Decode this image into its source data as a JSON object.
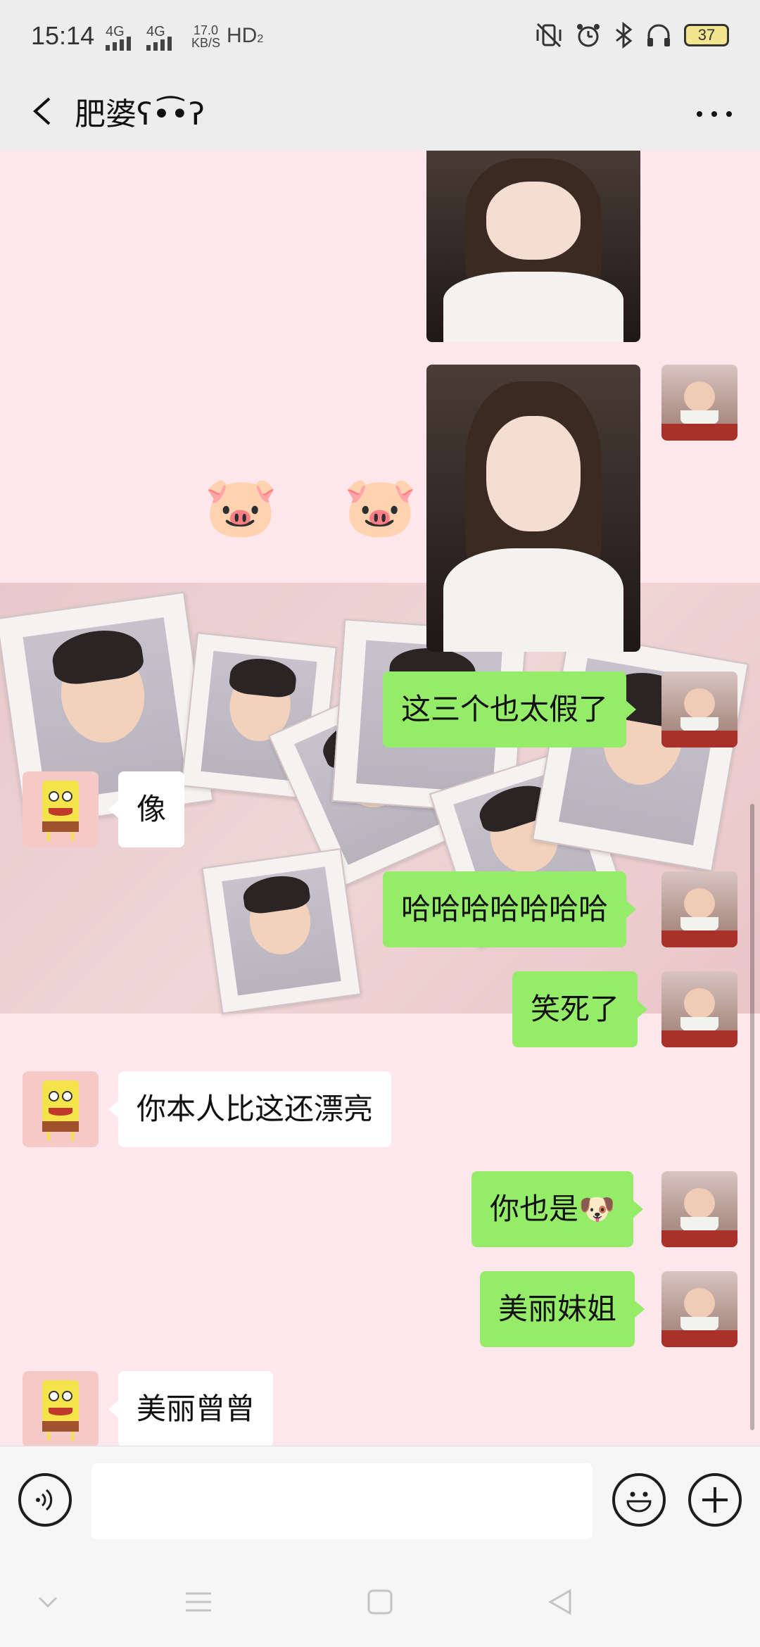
{
  "status_bar": {
    "time": "15:14",
    "signal1": "4G",
    "signal2": "4G",
    "speed_value": "17.0",
    "speed_unit": "KB/S",
    "hd": "HD",
    "hd_sub": "2",
    "battery": "37"
  },
  "header": {
    "title": "肥婆ʕ•͡•ʔ"
  },
  "messages": [
    {
      "side": "me",
      "type": "image"
    },
    {
      "side": "me",
      "type": "image"
    },
    {
      "side": "me",
      "type": "text",
      "text": "这三个也太假了"
    },
    {
      "side": "other",
      "type": "text",
      "text": "像"
    },
    {
      "side": "me",
      "type": "text",
      "text": "哈哈哈哈哈哈哈"
    },
    {
      "side": "me",
      "type": "text",
      "text": "笑死了"
    },
    {
      "side": "other",
      "type": "text",
      "text": "你本人比这还漂亮"
    },
    {
      "side": "me",
      "type": "text",
      "text": "你也是🐶"
    },
    {
      "side": "me",
      "type": "text",
      "text": "美丽妹姐"
    },
    {
      "side": "other",
      "type": "text",
      "text": "美丽曾曾"
    }
  ],
  "wallpaper_emoji": "🐷",
  "input": {
    "value": "",
    "placeholder": ""
  },
  "icons": {
    "back": "back-arrow-icon",
    "more": "more-options-icon",
    "voice": "voice-icon",
    "emoji": "emoji-icon",
    "add": "add-icon"
  },
  "colors": {
    "sent_bubble": "#95ec69",
    "received_bubble": "#ffffff",
    "chat_background": "#fde7ec",
    "bar_background": "#ededed"
  }
}
